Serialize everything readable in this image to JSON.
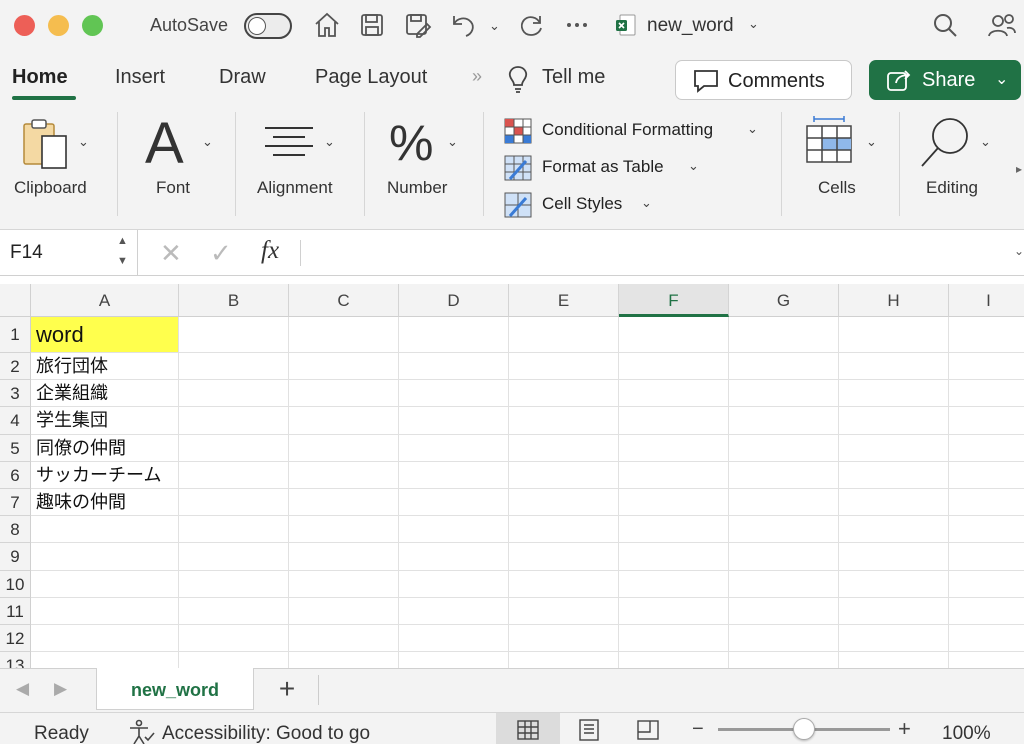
{
  "titlebar": {
    "autosave_label": "AutoSave",
    "document_title": "new_word"
  },
  "tabs": {
    "home": "Home",
    "insert": "Insert",
    "draw": "Draw",
    "page_layout": "Page Layout",
    "more": "»",
    "tell_me": "Tell me",
    "comments": "Comments",
    "share": "Share"
  },
  "ribbon": {
    "clipboard": "Clipboard",
    "font": "Font",
    "alignment": "Alignment",
    "number": "Number",
    "conditional_formatting": "Conditional Formatting",
    "format_as_table": "Format as Table",
    "cell_styles": "Cell Styles",
    "cells": "Cells",
    "editing": "Editing"
  },
  "formula_bar": {
    "name_box": "F14",
    "formula": ""
  },
  "grid": {
    "columns": [
      "A",
      "B",
      "C",
      "D",
      "E",
      "F",
      "G",
      "H",
      "I"
    ],
    "selected_column": "F",
    "rows": [
      "1",
      "2",
      "3",
      "4",
      "5",
      "6",
      "7",
      "8",
      "9",
      "10",
      "11",
      "12",
      "13"
    ],
    "cells_A": [
      "word",
      "旅行団体",
      "企業組織",
      "学生集団",
      "同僚の仲間",
      "サッカーチーム",
      "趣味の仲間"
    ]
  },
  "sheet_tabs": {
    "active": "new_word",
    "add": "+"
  },
  "status_bar": {
    "ready": "Ready",
    "accessibility": "Accessibility: Good to go",
    "zoom": "100%",
    "zoom_level": 1.0
  },
  "colors": {
    "accent": "#207245",
    "header_fill": "#ffff4d"
  }
}
